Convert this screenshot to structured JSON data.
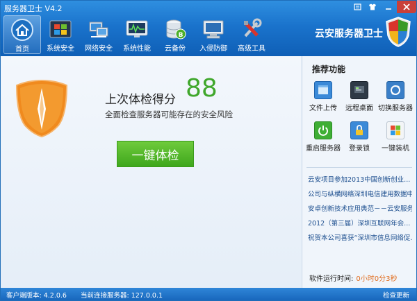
{
  "window": {
    "title": "服务器卫士 V4.2"
  },
  "nav": [
    {
      "label": "首页",
      "icon": "home-icon"
    },
    {
      "label": "系统安全",
      "icon": "windows-icon"
    },
    {
      "label": "网络安全",
      "icon": "network-icon"
    },
    {
      "label": "系统性能",
      "icon": "monitor-icon"
    },
    {
      "label": "云备份",
      "icon": "database-icon"
    },
    {
      "label": "入侵防御",
      "icon": "computer-icon"
    },
    {
      "label": "高级工具",
      "icon": "tools-icon"
    }
  ],
  "brand": {
    "name": "云安服务器卫士"
  },
  "main": {
    "score_title": "上次体检得分",
    "score": "88",
    "description": "全面检查服务器可能存在的安全风险",
    "scan_button": "一键体检"
  },
  "side": {
    "title": "推荐功能",
    "tools": [
      {
        "label": "文件上传",
        "icon": "file-upload-icon"
      },
      {
        "label": "远程桌面",
        "icon": "remote-desktop-icon"
      },
      {
        "label": "切换服务器",
        "icon": "switch-server-icon"
      },
      {
        "label": "重启服务器",
        "icon": "power-icon"
      },
      {
        "label": "登录锁",
        "icon": "lock-icon"
      },
      {
        "label": "一键装机",
        "icon": "windows-logo-icon"
      }
    ],
    "news": [
      "云安项目参加2013中国创新创业...",
      "公司与纵横网络深圳电信建用数据中...",
      "安卓创新技术应用典范－－云安服务...",
      "2012（第三届）深圳互联网年会...",
      "祝贺本公司喜获“深圳市信息网络促..."
    ],
    "runtime_label": "软件运行时间:",
    "runtime_value": "0小时0分3秒"
  },
  "status": {
    "client_version": "客户端版本: 4.2.0.6",
    "connected_server": "当前连接服务器: 127.0.0.1",
    "check_update": "检查更新"
  },
  "colors": {
    "header": "#1a73cc",
    "score": "#3fa72b",
    "button": "#4fb426",
    "shield": "#f08a1e"
  }
}
